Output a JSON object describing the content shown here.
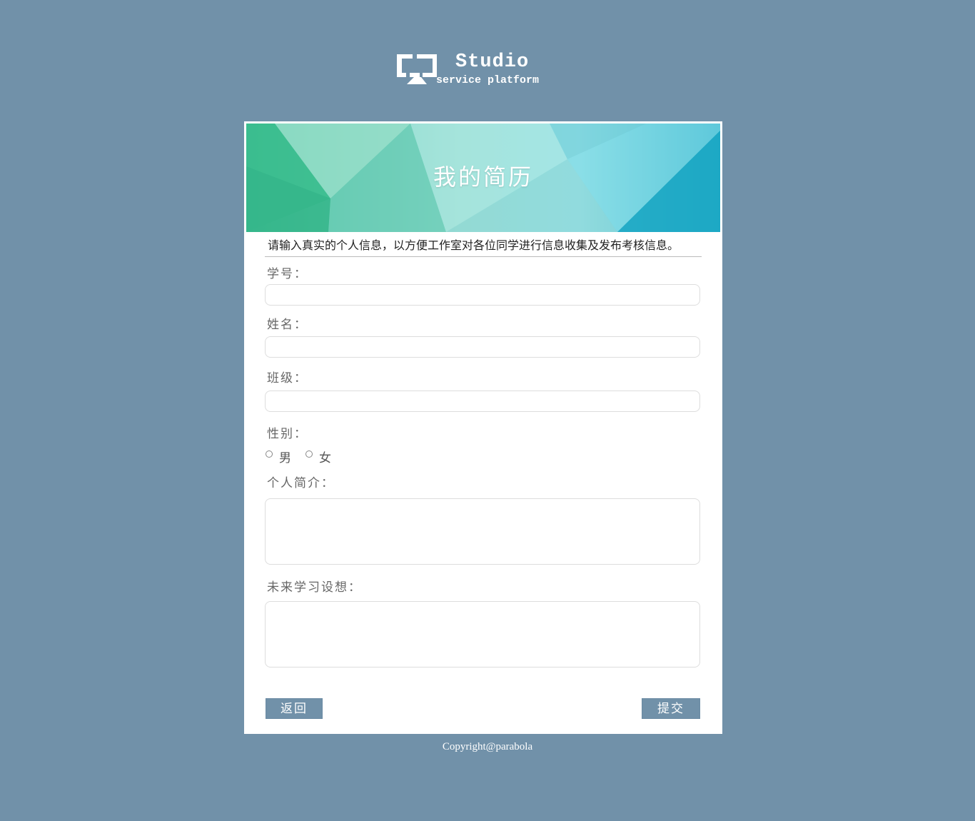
{
  "logo": {
    "name": "Studio",
    "tagline": "service platform"
  },
  "banner": {
    "title": "我的简历"
  },
  "form": {
    "intro": "请输入真实的个人信息，以方便工作室对各位同学进行信息收集及发布考核信息。",
    "student_id_label": "学号：",
    "student_id_value": "",
    "name_label": "姓名：",
    "name_value": "",
    "class_label": "班级：",
    "class_value": "",
    "gender_label": "性别：",
    "gender_options": [
      "男",
      "女"
    ],
    "profile_label": "个人简介：",
    "profile_value": "",
    "future_label": "未来学习设想：",
    "future_value": ""
  },
  "buttons": {
    "back": "返回",
    "submit": "提交"
  },
  "footer": {
    "copyright": "Copyright@parabola"
  },
  "colors": {
    "background": "#7191a9",
    "button": "#7191a9",
    "banner_left": "#3dbb93",
    "banner_right": "#1aa8c6"
  }
}
